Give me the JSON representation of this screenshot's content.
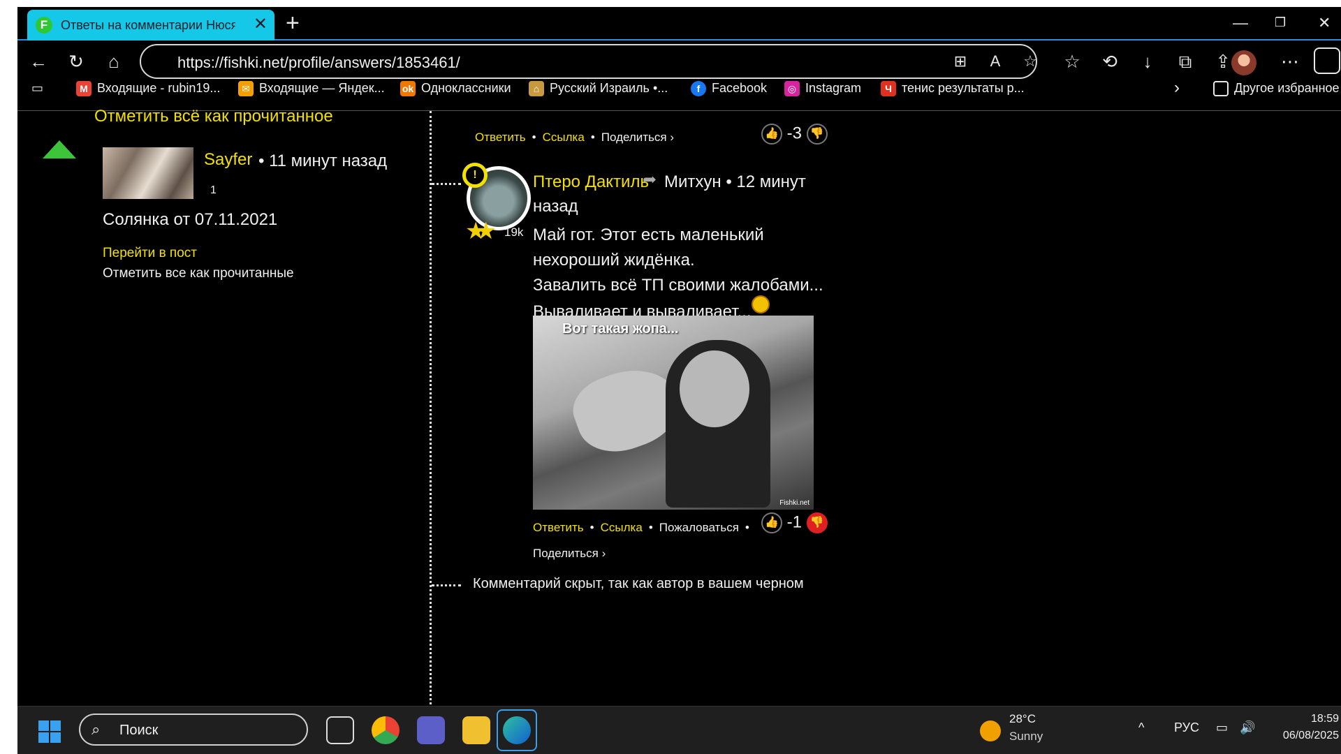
{
  "browser": {
    "tab_title": "Ответы на комментарии Нюся н",
    "url": "https://fishki.net/profile/answers/1853461/"
  },
  "bookmarks": [
    {
      "label": "Входящие - rubin19...",
      "icon": "gmail-icon",
      "color": "#ea4335"
    },
    {
      "label": "Входящие — Яндек...",
      "icon": "mail-icon",
      "color": "#f5a000"
    },
    {
      "label": "Одноклассники",
      "icon": "ok-icon",
      "color": "#f07800"
    },
    {
      "label": "Русский Израиль •...",
      "icon": "house-icon",
      "color": "#c89a40"
    },
    {
      "label": "Facebook",
      "icon": "facebook-icon",
      "color": "#1877f2"
    },
    {
      "label": "Instagram",
      "icon": "instagram-icon",
      "color": "#d6249f"
    },
    {
      "label": "тенис результаты р...",
      "icon": "flag-icon",
      "color": "#e03020"
    },
    {
      "label": "Другое избранное",
      "icon": "folder-icon",
      "color": "#e8e8e8"
    }
  ],
  "left": {
    "mark_all_top": "Отметить всё как прочитанное",
    "user": "Sayfer",
    "time": "• 11 минут назад",
    "count": "1",
    "post_title": "Солянка от 07.11.2021",
    "goto_post": "Перейти в пост",
    "mark_read": "Отметить все как прочитанные"
  },
  "comment_top": {
    "reply": "Ответить",
    "link": "Ссылка",
    "share": "Поделиться ›",
    "score": "-3"
  },
  "comment": {
    "author": "Птеро Дактиль",
    "reply_to": "Митхун • 12 минут",
    "time": "назад",
    "rating": "19k",
    "line1": "Май гот. Этот есть маленький",
    "line2": "нехороший жидёнка.",
    "line3": "Завалить всё ТП своими жалобами...",
    "line4": "Вываливает и вываливает...",
    "meme_caption": "Вот такая жопа...",
    "meme_watermark": "Fishki.net",
    "reply": "Ответить",
    "link": "Ссылка",
    "complain": "Пожаловаться",
    "share": "Поделиться ›",
    "score": "-1"
  },
  "hidden_note": "Комментарий скрыт, так как автор в вашем черном",
  "taskbar": {
    "search_placeholder": "Поиск",
    "temp": "28°C",
    "condition": "Sunny",
    "lang": "РУС",
    "time": "18:59",
    "date": "06/08/2025"
  }
}
